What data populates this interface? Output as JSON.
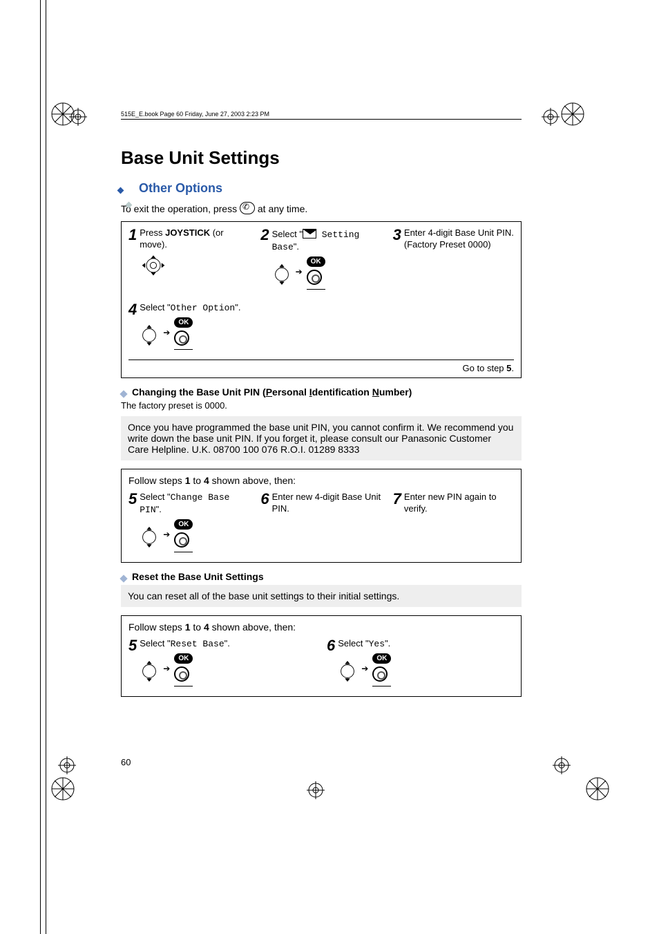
{
  "header": {
    "running": "515E_E.book  Page 60  Friday, June 27, 2003  2:23 PM"
  },
  "title": "Base Unit Settings",
  "section": "Other Options",
  "intro_a": "To exit the operation, press ",
  "intro_b": " at any time.",
  "steps_top": {
    "s1a": "Press ",
    "s1b": "JOYSTICK",
    "s1c": " (or move).",
    "s2a": "Select \"",
    "s2b": " Setting Base",
    "s2c": "\".",
    "s3": "Enter 4-digit Base Unit PIN.\n(Factory Preset 0000)",
    "s4a": "Select \"",
    "s4b": "Other Option",
    "s4c": "\".",
    "footer_a": "Go to step ",
    "footer_b": "5",
    "footer_c": "."
  },
  "sub1_title_a": "Changing the Base Unit PIN (",
  "sub1_title_p": "P",
  "sub1_title_b": "ersonal ",
  "sub1_title_i": "I",
  "sub1_title_c": "dentification ",
  "sub1_title_n": "N",
  "sub1_title_d": "umber)",
  "sub1_text": "The factory preset is 0000.",
  "note": "Once you have programmed the base unit PIN, you cannot confirm it. We recommend you write down the base unit PIN. If you forget it, please consult our Panasonic Customer Care Helpline. U.K. 08700 100 076 R.O.I. 01289 8333",
  "follow_a": "Follow steps ",
  "follow_b1": "1",
  "follow_c": " to ",
  "follow_b2": "4",
  "follow_d": " shown above, then:",
  "steps_mid": {
    "s5a": "Select \"",
    "s5b": "Change Base PIN",
    "s5c": "\".",
    "s6": "Enter new 4-digit Base Unit PIN.",
    "s7": "Enter new PIN again to verify."
  },
  "sub2_title": "Reset the Base Unit Settings",
  "sub2_text": "You can reset all of the base unit settings to their initial settings.",
  "steps_bot": {
    "s5a": "Select \"",
    "s5b": "Reset Base",
    "s5c": "\".",
    "s6a": "Select \"",
    "s6b": "Yes",
    "s6c": "\"."
  },
  "page_number": "60",
  "ok_label": "OK"
}
